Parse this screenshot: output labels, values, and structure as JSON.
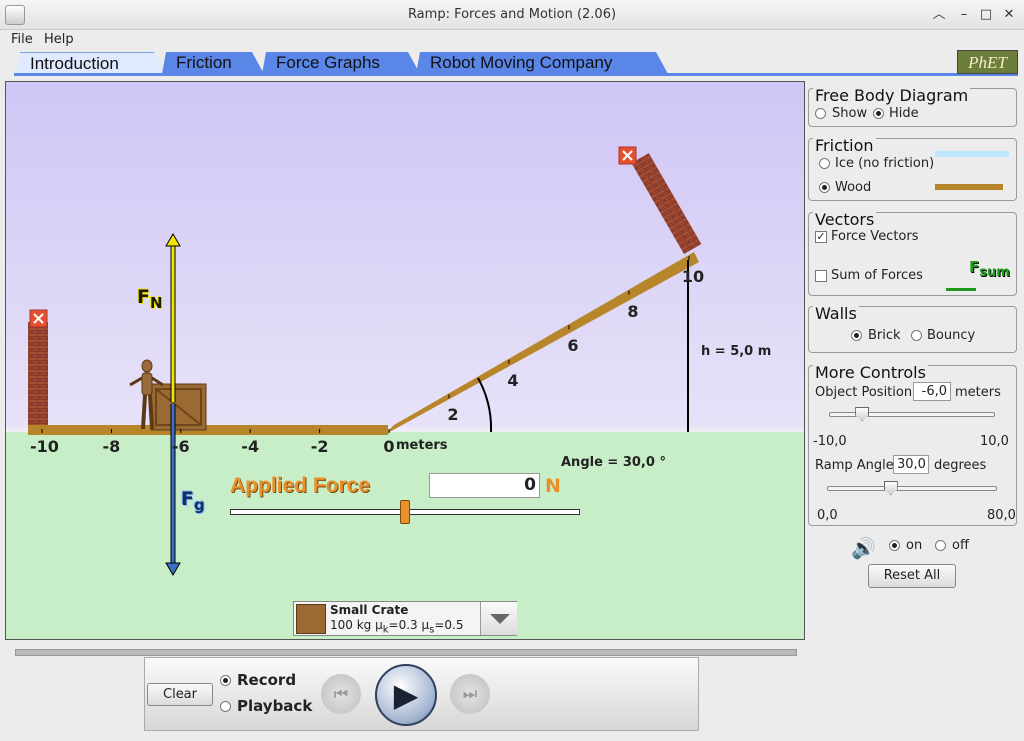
{
  "window": {
    "title": "Ramp: Forces and Motion (2.06)"
  },
  "menu": {
    "file": "File",
    "help": "Help"
  },
  "tabs": [
    "Introduction",
    "Friction",
    "Force Graphs",
    "Robot Moving Company"
  ],
  "logo": "PhET",
  "play": {
    "tick_labels": [
      "-10",
      "-8",
      "-6",
      "-4",
      "-2",
      "0",
      "2",
      "4",
      "6",
      "8",
      "10"
    ],
    "units": "meters",
    "height_label": "h = 5,0 m",
    "angle_label": "Angle = 30,0 °",
    "fn_label": "F",
    "fn_sub": "N",
    "fg_label": "F",
    "fg_sub": "g",
    "applied_force_label": "Applied Force",
    "applied_force_value": "0",
    "applied_force_unit": "N",
    "applied_force_fraction": 0.5,
    "object_name": "Small Crate",
    "object_desc_mass": "100 kg ",
    "object_mu_k": "μ",
    "object_mu_k_sub": "k",
    "object_mu_k_val": "=0.3 ",
    "object_mu_s": "μ",
    "object_mu_s_sub": "s",
    "object_mu_s_val": "=0.5"
  },
  "panels": {
    "fbd": {
      "title": "Free Body Diagram",
      "show": "Show",
      "hide": "Hide",
      "selected": "Hide"
    },
    "friction": {
      "title": "Friction",
      "ice": "Ice (no friction)",
      "wood": "Wood",
      "selected": "Wood"
    },
    "vectors": {
      "title": "Vectors",
      "force_vectors": "Force Vectors",
      "sum_of_forces": "Sum of Forces",
      "fsum": "F",
      "fsum_sub": "sum",
      "force_vectors_checked": true,
      "sum_checked": false
    },
    "walls": {
      "title": "Walls",
      "brick": "Brick",
      "bouncy": "Bouncy",
      "selected": "Brick"
    },
    "more": {
      "title": "More Controls",
      "object_position_label": "Object Position",
      "object_position_value": "-6,0",
      "object_position_unit": "meters",
      "pos_min": "-10,0",
      "pos_max": "10,0",
      "pos_value": -6.0,
      "ramp_angle_label": "Ramp Angle",
      "ramp_angle_value": "30,0",
      "ramp_angle_unit": "degrees",
      "angle_min": "0,0",
      "angle_max": "80,0",
      "angle_value": 30.0
    }
  },
  "sound": {
    "on": "on",
    "off": "off",
    "selected": "on"
  },
  "reset_all": "Reset All",
  "playback": {
    "clear": "Clear",
    "record": "Record",
    "playback": "Playback",
    "mode": "Record"
  },
  "colors": {
    "tab_blue": "#5a86e8",
    "ramp": "#b8862a",
    "normal": "#f3e500",
    "gravity": "#3b6fc4",
    "applied": "#e8902a",
    "sum": "#1f9a1f"
  }
}
